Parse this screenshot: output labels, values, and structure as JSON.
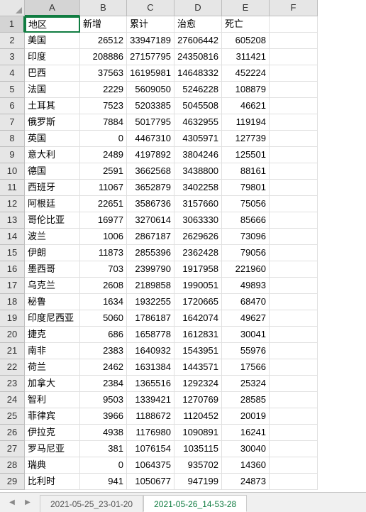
{
  "columns": [
    "A",
    "B",
    "C",
    "D",
    "E",
    "F"
  ],
  "headers": [
    "地区",
    "新增",
    "累计",
    "治愈",
    "死亡",
    ""
  ],
  "rows": [
    [
      "美国",
      26512,
      33947189,
      27606442,
      605208,
      ""
    ],
    [
      "印度",
      208886,
      27157795,
      24350816,
      311421,
      ""
    ],
    [
      "巴西",
      37563,
      16195981,
      14648332,
      452224,
      ""
    ],
    [
      "法国",
      2229,
      5609050,
      5246228,
      108879,
      ""
    ],
    [
      "土耳其",
      7523,
      5203385,
      5045508,
      46621,
      ""
    ],
    [
      "俄罗斯",
      7884,
      5017795,
      4632955,
      119194,
      ""
    ],
    [
      "英国",
      0,
      4467310,
      4305971,
      127739,
      ""
    ],
    [
      "意大利",
      2489,
      4197892,
      3804246,
      125501,
      ""
    ],
    [
      "德国",
      2591,
      3662568,
      3438800,
      88161,
      ""
    ],
    [
      "西班牙",
      11067,
      3652879,
      3402258,
      79801,
      ""
    ],
    [
      "阿根廷",
      22651,
      3586736,
      3157660,
      75056,
      ""
    ],
    [
      "哥伦比亚",
      16977,
      3270614,
      3063330,
      85666,
      ""
    ],
    [
      "波兰",
      1006,
      2867187,
      2629626,
      73096,
      ""
    ],
    [
      "伊朗",
      11873,
      2855396,
      2362428,
      79056,
      ""
    ],
    [
      "墨西哥",
      703,
      2399790,
      1917958,
      221960,
      ""
    ],
    [
      "乌克兰",
      2608,
      2189858,
      1990051,
      49893,
      ""
    ],
    [
      "秘鲁",
      1634,
      1932255,
      1720665,
      68470,
      ""
    ],
    [
      "印度尼西亚",
      5060,
      1786187,
      1642074,
      49627,
      ""
    ],
    [
      "捷克",
      686,
      1658778,
      1612831,
      30041,
      ""
    ],
    [
      "南非",
      2383,
      1640932,
      1543951,
      55976,
      ""
    ],
    [
      "荷兰",
      2462,
      1631384,
      1443571,
      17566,
      ""
    ],
    [
      "加拿大",
      2384,
      1365516,
      1292324,
      25324,
      ""
    ],
    [
      "智利",
      9503,
      1339421,
      1270769,
      28585,
      ""
    ],
    [
      "菲律宾",
      3966,
      1188672,
      1120452,
      20019,
      ""
    ],
    [
      "伊拉克",
      4938,
      1176980,
      1090891,
      16241,
      ""
    ],
    [
      "罗马尼亚",
      381,
      1076154,
      1035115,
      30040,
      ""
    ],
    [
      "瑞典",
      0,
      1064375,
      935702,
      14360,
      ""
    ],
    [
      "比利时",
      941,
      1050677,
      947199,
      24873,
      ""
    ]
  ],
  "selected_cell": {
    "row": 1,
    "col": "A"
  },
  "tabs": [
    {
      "label": "2021-05-25_23-01-20",
      "active": false
    },
    {
      "label": "2021-05-26_14-53-28",
      "active": true
    }
  ],
  "chart_data": {
    "type": "table",
    "title": "",
    "headers": [
      "地区",
      "新增",
      "累计",
      "治愈",
      "死亡"
    ],
    "data": [
      [
        "美国",
        26512,
        33947189,
        27606442,
        605208
      ],
      [
        "印度",
        208886,
        27157795,
        24350816,
        311421
      ],
      [
        "巴西",
        37563,
        16195981,
        14648332,
        452224
      ],
      [
        "法国",
        2229,
        5609050,
        5246228,
        108879
      ],
      [
        "土耳其",
        7523,
        5203385,
        5045508,
        46621
      ],
      [
        "俄罗斯",
        7884,
        5017795,
        4632955,
        119194
      ],
      [
        "英国",
        0,
        4467310,
        4305971,
        127739
      ],
      [
        "意大利",
        2489,
        4197892,
        3804246,
        125501
      ],
      [
        "德国",
        2591,
        3662568,
        3438800,
        88161
      ],
      [
        "西班牙",
        11067,
        3652879,
        3402258,
        79801
      ],
      [
        "阿根廷",
        22651,
        3586736,
        3157660,
        75056
      ],
      [
        "哥伦比亚",
        16977,
        3270614,
        3063330,
        85666
      ],
      [
        "波兰",
        1006,
        2867187,
        2629626,
        73096
      ],
      [
        "伊朗",
        11873,
        2855396,
        2362428,
        79056
      ],
      [
        "墨西哥",
        703,
        2399790,
        1917958,
        221960
      ],
      [
        "乌克兰",
        2608,
        2189858,
        1990051,
        49893
      ],
      [
        "秘鲁",
        1634,
        1932255,
        1720665,
        68470
      ],
      [
        "印度尼西亚",
        5060,
        1786187,
        1642074,
        49627
      ],
      [
        "捷克",
        686,
        1658778,
        1612831,
        30041
      ],
      [
        "南非",
        2383,
        1640932,
        1543951,
        55976
      ],
      [
        "荷兰",
        2462,
        1631384,
        1443571,
        17566
      ],
      [
        "加拿大",
        2384,
        1365516,
        1292324,
        25324
      ],
      [
        "智利",
        9503,
        1339421,
        1270769,
        28585
      ],
      [
        "菲律宾",
        3966,
        1188672,
        1120452,
        20019
      ],
      [
        "伊拉克",
        4938,
        1176980,
        1090891,
        16241
      ],
      [
        "罗马尼亚",
        381,
        1076154,
        1035115,
        30040
      ],
      [
        "瑞典",
        0,
        1064375,
        935702,
        14360
      ],
      [
        "比利时",
        941,
        1050677,
        947199,
        24873
      ]
    ]
  }
}
